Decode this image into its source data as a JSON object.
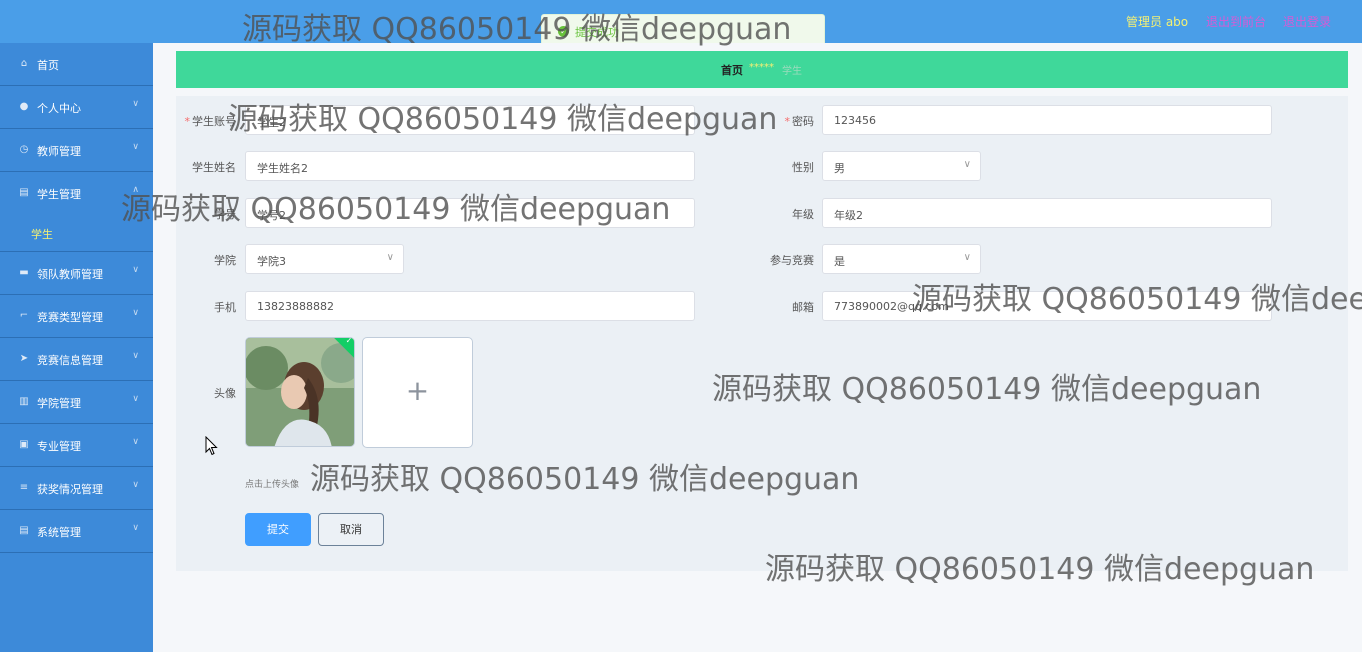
{
  "header": {
    "admin": "管理员 abo",
    "front": "退出到前台",
    "logout": "退出登录"
  },
  "toast": {
    "message": "提交成功"
  },
  "sidebar": {
    "items": [
      {
        "label": "首页",
        "icon": "home-icon"
      },
      {
        "label": "个人中心",
        "icon": "user-icon"
      },
      {
        "label": "教师管理",
        "icon": "clock-icon"
      },
      {
        "label": "学生管理",
        "icon": "clipboard-icon"
      },
      {
        "label": "领队教师管理",
        "icon": "video-icon"
      },
      {
        "label": "竞赛类型管理",
        "icon": "crop-icon"
      },
      {
        "label": "竞赛信息管理",
        "icon": "send-icon"
      },
      {
        "label": "学院管理",
        "icon": "book-icon"
      },
      {
        "label": "专业管理",
        "icon": "briefcase-icon"
      },
      {
        "label": "获奖情况管理",
        "icon": "list-icon"
      },
      {
        "label": "系统管理",
        "icon": "clipboard-icon"
      }
    ],
    "submenu": "学生"
  },
  "breadcrumb": {
    "home": "首页",
    "sep": "*****",
    "current": "学生"
  },
  "form": {
    "account_label": "学生账号",
    "account_value": "学生2",
    "password_label": "密码",
    "password_value": "123456",
    "name_label": "学生姓名",
    "name_value": "学生姓名2",
    "gender_label": "性别",
    "gender_value": "男",
    "number_label": "学号",
    "number_value": "学号2",
    "grade_label": "年级",
    "grade_value": "年级2",
    "college_label": "学院",
    "college_value": "学院3",
    "competition_label": "参与竞赛",
    "competition_value": "是",
    "phone_label": "手机",
    "phone_value": "13823888882",
    "email_label": "邮箱",
    "email_value": "773890002@qq.com",
    "avatar_label": "头像",
    "upload_plus": "+",
    "upload_tip": "点击上传头像",
    "submit": "提交",
    "cancel": "取消"
  },
  "watermark": "源码获取 QQ86050149 微信deepguan",
  "colors": {
    "header": "#4a9ee8",
    "sidebar": "#3d8ad9",
    "breadcrumb": "#3fd89a",
    "primary": "#409eff"
  }
}
